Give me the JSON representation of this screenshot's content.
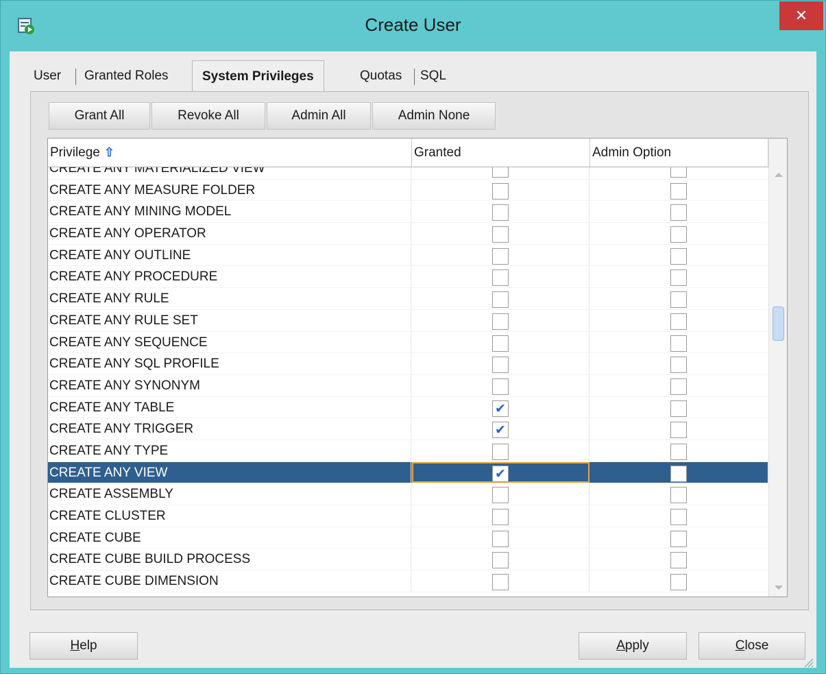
{
  "window": {
    "title": "Create User",
    "close_glyph": "✕"
  },
  "tabs": [
    {
      "label": "User",
      "active": false
    },
    {
      "label": "Granted Roles",
      "active": false
    },
    {
      "label": "System Privileges",
      "active": true
    },
    {
      "label": "Quotas",
      "active": false
    },
    {
      "label": "SQL",
      "active": false
    }
  ],
  "toolbar": {
    "grant_all": "Grant All",
    "revoke_all": "Revoke All",
    "admin_all": "Admin All",
    "admin_none": "Admin None"
  },
  "grid": {
    "columns": {
      "privilege": "Privilege",
      "granted": "Granted",
      "admin_option": "Admin Option"
    },
    "sort_icon": "⇧",
    "check_glyph": "✔",
    "rows": [
      {
        "privilege": "CREATE ANY MATERIALIZED VIEW",
        "granted": false,
        "admin": false
      },
      {
        "privilege": "CREATE ANY MEASURE FOLDER",
        "granted": false,
        "admin": false
      },
      {
        "privilege": "CREATE ANY MINING MODEL",
        "granted": false,
        "admin": false
      },
      {
        "privilege": "CREATE ANY OPERATOR",
        "granted": false,
        "admin": false
      },
      {
        "privilege": "CREATE ANY OUTLINE",
        "granted": false,
        "admin": false
      },
      {
        "privilege": "CREATE ANY PROCEDURE",
        "granted": false,
        "admin": false
      },
      {
        "privilege": "CREATE ANY RULE",
        "granted": false,
        "admin": false
      },
      {
        "privilege": "CREATE ANY RULE SET",
        "granted": false,
        "admin": false
      },
      {
        "privilege": "CREATE ANY SEQUENCE",
        "granted": false,
        "admin": false
      },
      {
        "privilege": "CREATE ANY SQL PROFILE",
        "granted": false,
        "admin": false
      },
      {
        "privilege": "CREATE ANY SYNONYM",
        "granted": false,
        "admin": false
      },
      {
        "privilege": "CREATE ANY TABLE",
        "granted": true,
        "admin": false
      },
      {
        "privilege": "CREATE ANY TRIGGER",
        "granted": true,
        "admin": false
      },
      {
        "privilege": "CREATE ANY TYPE",
        "granted": false,
        "admin": false
      },
      {
        "privilege": "CREATE ANY VIEW",
        "granted": true,
        "admin": false,
        "selected": true
      },
      {
        "privilege": "CREATE ASSEMBLY",
        "granted": false,
        "admin": false
      },
      {
        "privilege": "CREATE CLUSTER",
        "granted": false,
        "admin": false
      },
      {
        "privilege": "CREATE CUBE",
        "granted": false,
        "admin": false
      },
      {
        "privilege": "CREATE CUBE BUILD PROCESS",
        "granted": false,
        "admin": false
      },
      {
        "privilege": "CREATE CUBE DIMENSION",
        "granted": false,
        "admin": false
      }
    ]
  },
  "footer": {
    "help": {
      "mnemonic": "H",
      "rest": "elp"
    },
    "apply": {
      "mnemonic": "A",
      "rest": "pply"
    },
    "close": {
      "mnemonic": "C",
      "rest": "lose"
    }
  },
  "colors": {
    "title_bar": "#5fc9cf",
    "close_button": "#c9393a",
    "selection": "#2f5f8f",
    "focus_outline": "#e8a33a",
    "checkmark": "#2a63c8"
  }
}
